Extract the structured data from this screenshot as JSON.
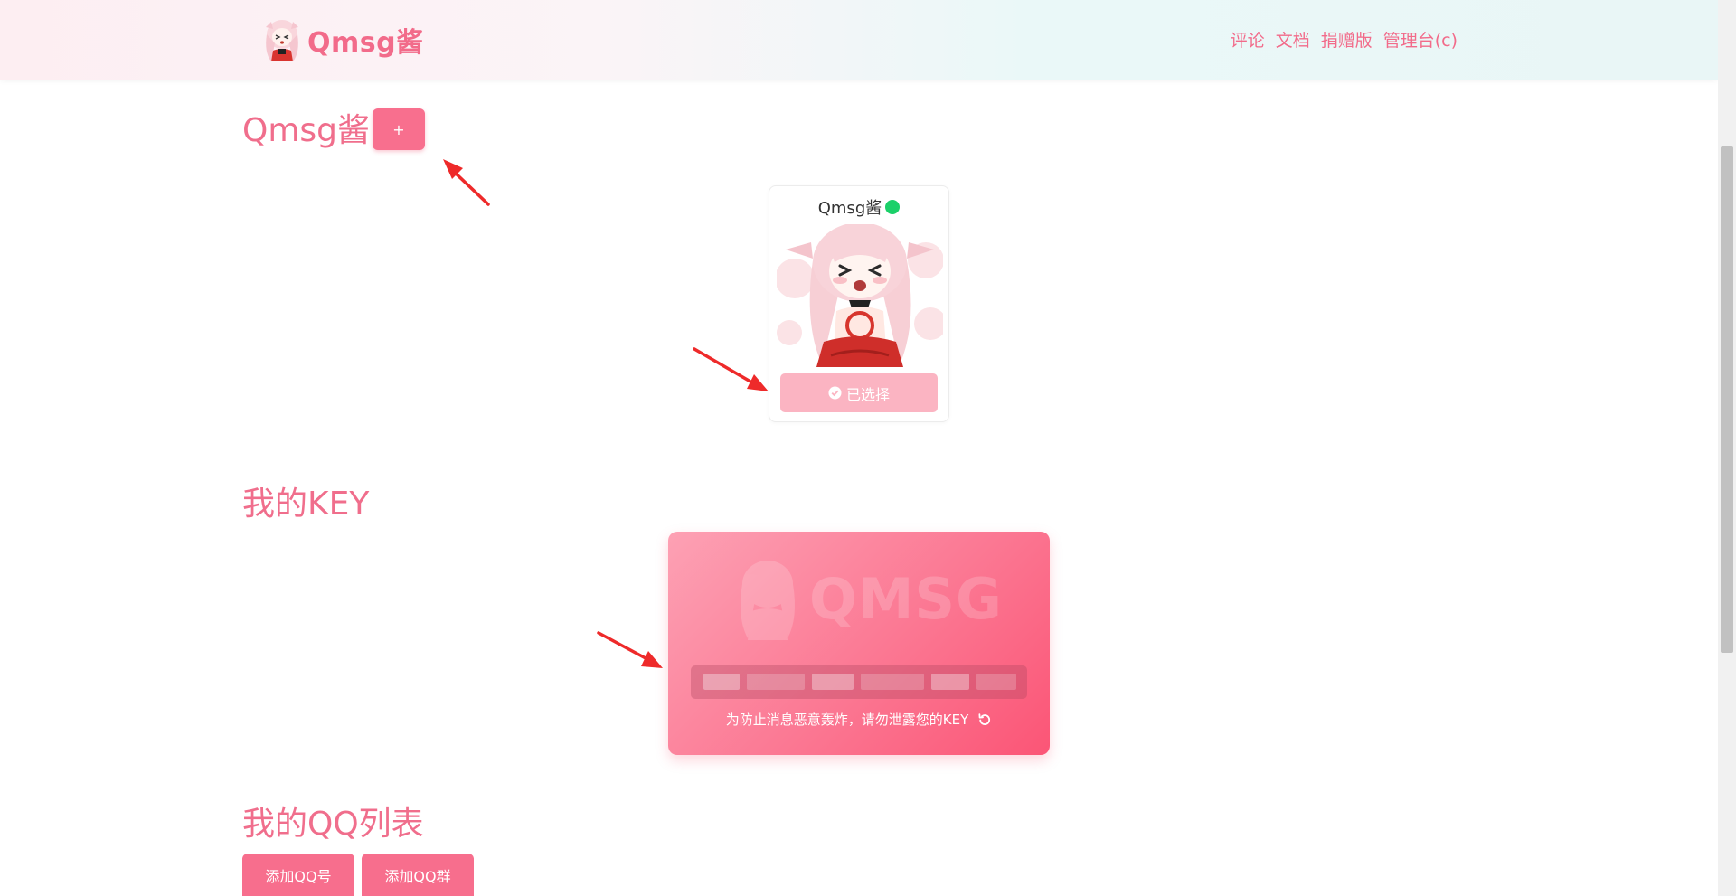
{
  "header": {
    "brand_name": "Qmsg酱",
    "nav": [
      {
        "label": "评论"
      },
      {
        "label": "文档"
      },
      {
        "label": "捐赠版"
      },
      {
        "label": "管理台(c)"
      }
    ]
  },
  "bot_section": {
    "title": "Qmsg酱",
    "add_label": "+",
    "card": {
      "name": "Qmsg酱",
      "status": "online",
      "status_color": "#1bd069",
      "selected_label": "已选择",
      "selected_icon": "check-circle-icon"
    }
  },
  "key_section": {
    "title": "我的KEY",
    "watermark_text": "QMSG",
    "warning_text": "为防止消息恶意轰炸，请勿泄露您的KEY",
    "refresh_icon": "refresh-icon"
  },
  "qq_section": {
    "title": "我的QQ列表",
    "buttons": [
      {
        "label": "添加QQ号"
      },
      {
        "label": "添加QQ群"
      }
    ]
  },
  "colors": {
    "accent": "#f06e8c",
    "button": "#f76e8d",
    "selected_button": "#fbb4c2",
    "annotation_arrow": "#ee2a2a"
  }
}
